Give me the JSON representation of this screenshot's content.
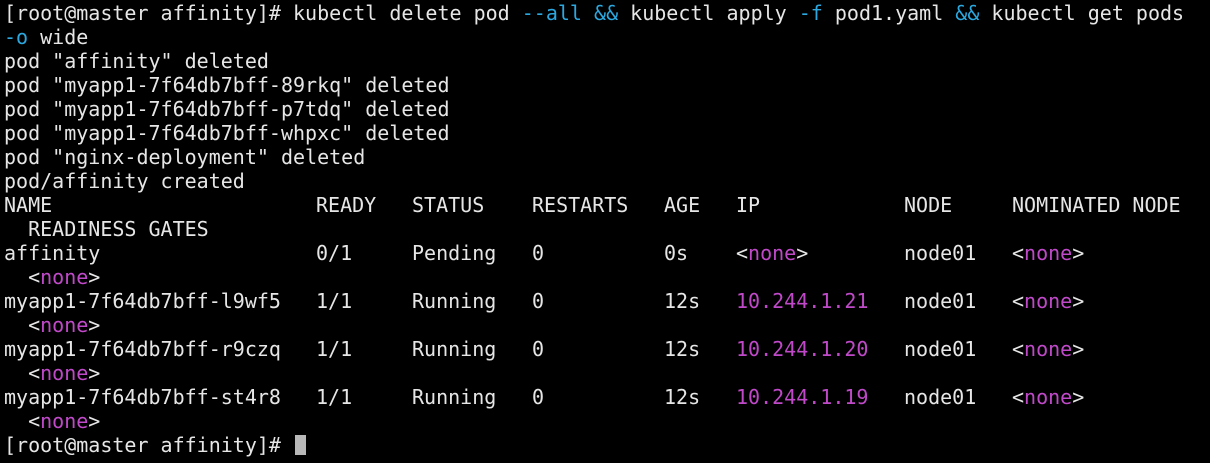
{
  "colors": {
    "background": "#000000",
    "text": "#e6e6e6",
    "operator": "#2ba8e0",
    "highlight": "#c049c9"
  },
  "command": {
    "prompt": "[root@master affinity]# ",
    "part1": "kubectl delete pod ",
    "flag_all": "--all",
    "op1": "&&",
    "part2": " kubectl apply ",
    "flag_f": "-f",
    "part3": " pod1.yaml ",
    "op2": "&&",
    "part4": " kubectl get pods",
    "flag_o": "-o",
    "part5": " wide"
  },
  "output": [
    "pod \"affinity\" deleted",
    "pod \"myapp1-7f64db7bff-89rkq\" deleted",
    "pod \"myapp1-7f64db7bff-p7tdq\" deleted",
    "pod \"myapp1-7f64db7bff-whpxc\" deleted",
    "pod \"nginx-deployment\" deleted",
    "pod/affinity created"
  ],
  "table": {
    "headers": {
      "name": "NAME",
      "ready": "READY",
      "status": "STATUS",
      "restarts": "RESTARTS",
      "age": "AGE",
      "ip": "IP",
      "node": "NODE",
      "nominated": "NOMINATED NODE",
      "readiness": "  READINESS GATES"
    },
    "rows": [
      {
        "name": "affinity",
        "ready": "0/1",
        "status": "Pending",
        "restarts": "0",
        "age": "0s",
        "ip_open": "<",
        "ip_value": "none",
        "ip_close": ">",
        "node": "node01",
        "nom_open": "<",
        "nom_value": "none",
        "nom_close": ">",
        "gates_open": "  <",
        "gates_value": "none",
        "gates_close": ">"
      },
      {
        "name": "myapp1-7f64db7bff-l9wf5",
        "ready": "1/1",
        "status": "Running",
        "restarts": "0",
        "age": "12s",
        "ip_open": "",
        "ip_value": "10.244.1.21",
        "ip_close": "",
        "node": "node01",
        "nom_open": "<",
        "nom_value": "none",
        "nom_close": ">",
        "gates_open": "  <",
        "gates_value": "none",
        "gates_close": ">"
      },
      {
        "name": "myapp1-7f64db7bff-r9czq",
        "ready": "1/1",
        "status": "Running",
        "restarts": "0",
        "age": "12s",
        "ip_open": "",
        "ip_value": "10.244.1.20",
        "ip_close": "",
        "node": "node01",
        "nom_open": "<",
        "nom_value": "none",
        "nom_close": ">",
        "gates_open": "  <",
        "gates_value": "none",
        "gates_close": ">"
      },
      {
        "name": "myapp1-7f64db7bff-st4r8",
        "ready": "1/1",
        "status": "Running",
        "restarts": "0",
        "age": "12s",
        "ip_open": "",
        "ip_value": "10.244.1.19",
        "ip_close": "",
        "node": "node01",
        "nom_open": "<",
        "nom_value": "none",
        "nom_close": ">",
        "gates_open": "  <",
        "gates_value": "none",
        "gates_close": ">"
      }
    ]
  },
  "final_prompt": "[root@master affinity]# "
}
